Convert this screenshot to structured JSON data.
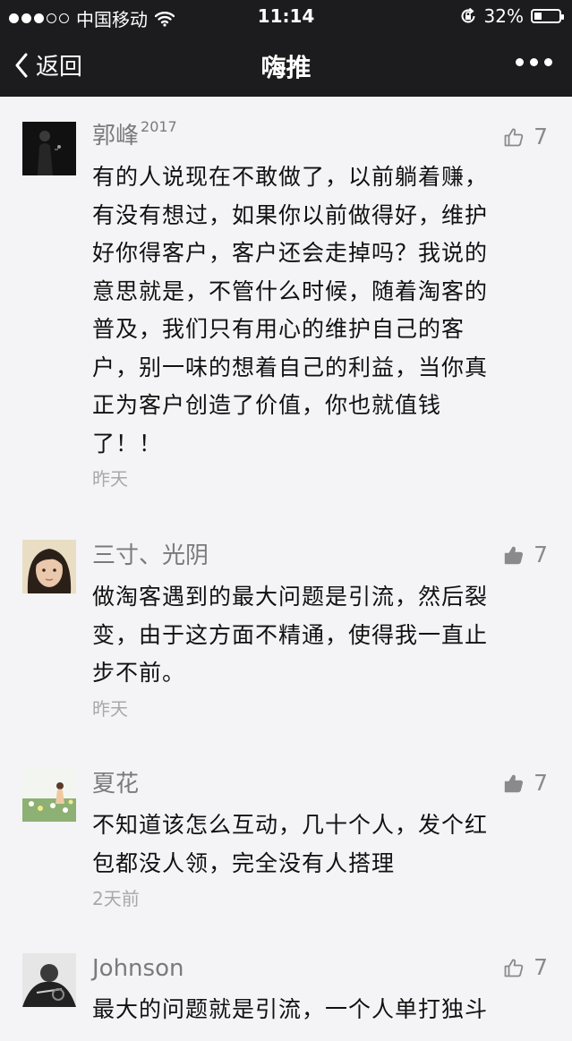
{
  "status_bar": {
    "carrier": "中国移动",
    "time": "11:14",
    "battery_percent": "32%",
    "battery_level": 0.32
  },
  "nav": {
    "back_label": "返回",
    "title": "嗨推"
  },
  "comments": [
    {
      "name": "郭峰",
      "name_sup": "2017",
      "likes": "7",
      "liked": false,
      "lines": [
        "有的人说现在不敢做了，以前躺着赚，",
        "有没有想过，如果你以前做得好，维护",
        "好你得客户，客户还会走掉吗？我说的",
        "意思就是，不管什么时候，随着淘客的",
        "普及，我们只有用心的维护自己的客",
        "户，别一味的想着自己的利益，当你真",
        "正为客户创造了价值，你也就值钱",
        "了！！"
      ],
      "time": "昨天"
    },
    {
      "name": "三寸、光阴",
      "likes": "7",
      "liked": true,
      "lines": [
        "做淘客遇到的最大问题是引流，然后裂",
        "变，由于这方面不精通，使得我一直止",
        "步不前。"
      ],
      "time": "昨天"
    },
    {
      "name": "夏花",
      "likes": "7",
      "liked": true,
      "lines": [
        "不知道该怎么互动，几十个人，发个红",
        "包都没人领，完全没有人搭理"
      ],
      "time": "2天前"
    },
    {
      "name": "Johnson",
      "likes": "7",
      "liked": false,
      "lines": [
        "最大的问题就是引流，一个人单打独斗"
      ]
    }
  ]
}
